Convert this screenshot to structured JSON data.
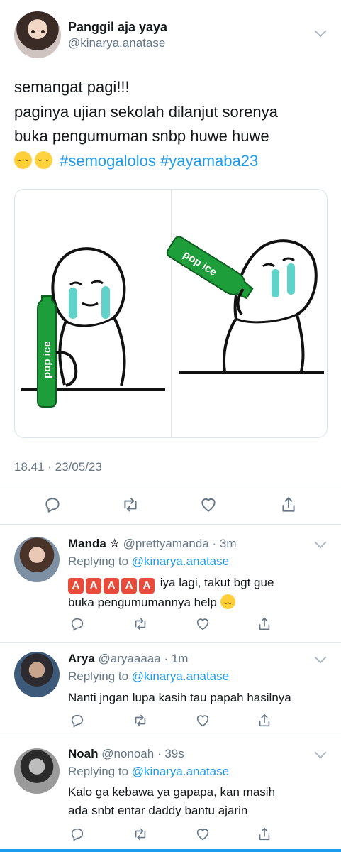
{
  "tweet": {
    "author_name": "Panggil aja yaya",
    "author_handle": "@kinarya.anatase",
    "text_lines": [
      "semangat pagi!!!",
      "paginya ujian sekolah dilanjut sorenya",
      "buka pengumuman snbp huwe huwe"
    ],
    "hashtags": "#semogalolos #yayamaba23",
    "emojis": [
      "pensive-face-emoji",
      "pleading-face-emoji"
    ],
    "image": {
      "left_bottle_label": "pop ice",
      "right_bottle_label": "pop ice",
      "bottle_color": "#1e9e3a",
      "tear_color": "#5fd3c9"
    },
    "timestamp": "18.41 · 23/05/23"
  },
  "replies": [
    {
      "name": "Manda",
      "badge": "✮",
      "handle": "@prettyamanda",
      "time": "· 3m",
      "replying_prefix": "Replying to",
      "replying_handle": "@kinarya.anatase",
      "badge_letters": [
        "A",
        "A",
        "A",
        "A",
        "A"
      ],
      "text_lines": [
        "iya lagi, takut bgt gue",
        "buka pengumumannya help"
      ]
    },
    {
      "name": "Arya",
      "handle": "@aryaaaaa",
      "time": "· 1m",
      "replying_prefix": "Replying to",
      "replying_handle": "@kinarya.anatase",
      "text_lines": [
        "Nanti jngan lupa kasih tau papah hasilnya"
      ]
    },
    {
      "name": "Noah",
      "handle": "@nonoah",
      "time": "· 39s",
      "replying_prefix": "Replying to",
      "replying_handle": "@kinarya.anatase",
      "text_lines": [
        "Kalo ga kebawa ya gapapa, kan masih",
        "ada snbt entar daddy bantu ajarin"
      ]
    }
  ],
  "colors": {
    "link_blue": "#1d9bf0",
    "secondary_grey": "#657786",
    "divider": "#e1e8ed"
  }
}
